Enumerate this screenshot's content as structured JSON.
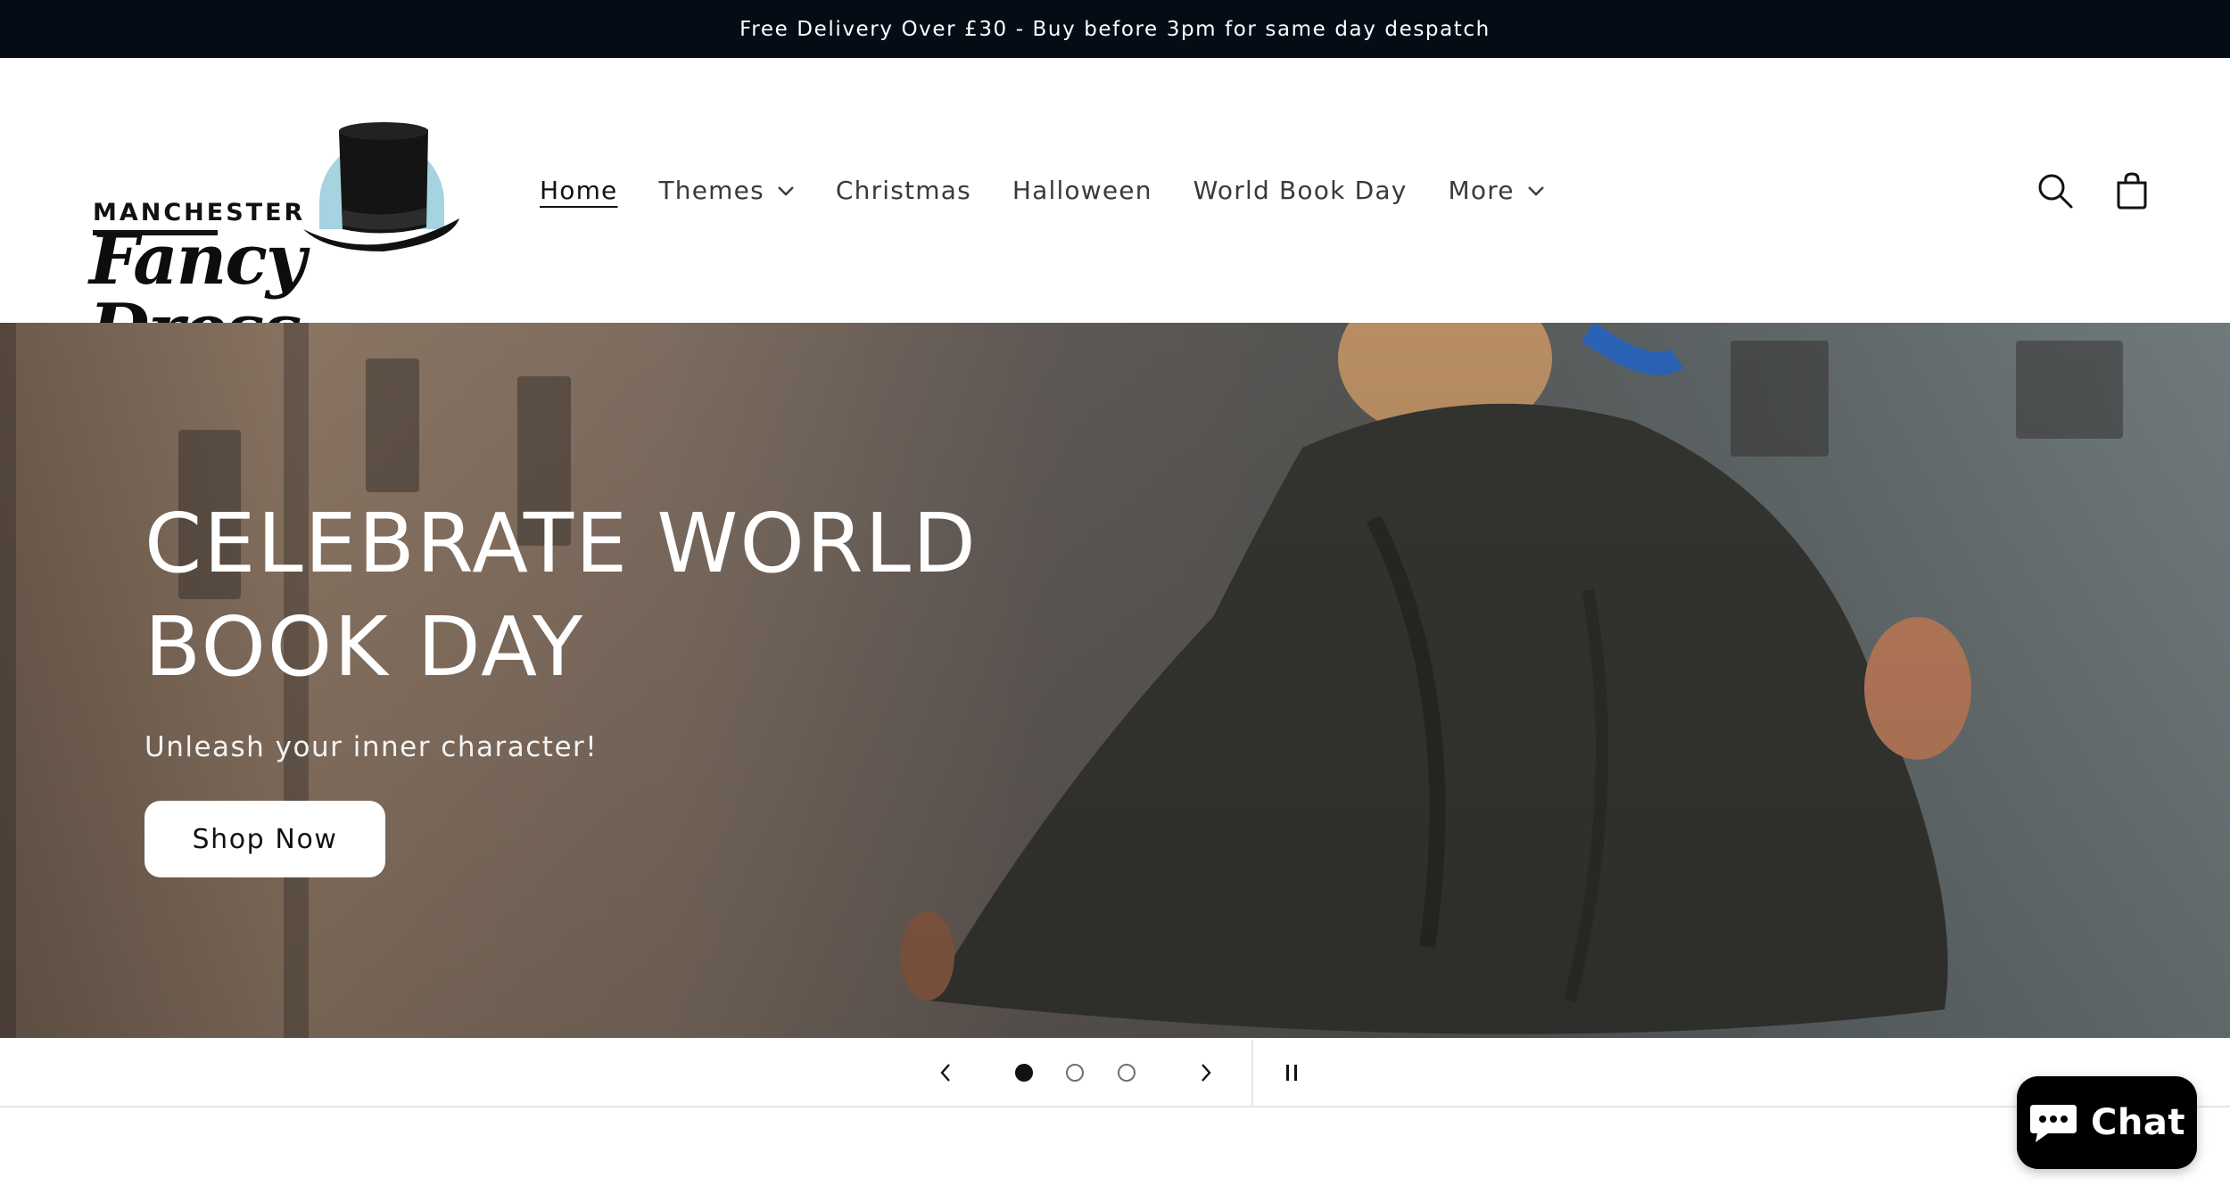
{
  "announcement": {
    "text": "Free Delivery Over £30 - Buy before 3pm for same day despatch"
  },
  "logo": {
    "line1": "MANCHESTER",
    "line2": "Fancy Dress",
    "icon": "top-hat-icon",
    "hat_color": "#111111",
    "disc_color": "#a6d3e0"
  },
  "nav": {
    "items": [
      {
        "label": "Home",
        "active": true,
        "has_dropdown": false
      },
      {
        "label": "Themes",
        "active": false,
        "has_dropdown": true
      },
      {
        "label": "Christmas",
        "active": false,
        "has_dropdown": false
      },
      {
        "label": "Halloween",
        "active": false,
        "has_dropdown": false
      },
      {
        "label": "World Book Day",
        "active": false,
        "has_dropdown": false
      },
      {
        "label": "More",
        "active": false,
        "has_dropdown": true
      }
    ]
  },
  "header_icons": [
    "search-icon",
    "cart-icon"
  ],
  "hero": {
    "title": "CELEBRATE WORLD BOOK DAY",
    "subtitle": "Unleash your inner character!",
    "button_label": "Shop Now"
  },
  "slideshow": {
    "slide_count": 3,
    "active_index": 0,
    "controls": [
      "previous-slide-icon",
      "next-slide-icon",
      "pause-icon"
    ]
  },
  "chat": {
    "label": "Chat",
    "icon": "chat-bubble-icon"
  }
}
